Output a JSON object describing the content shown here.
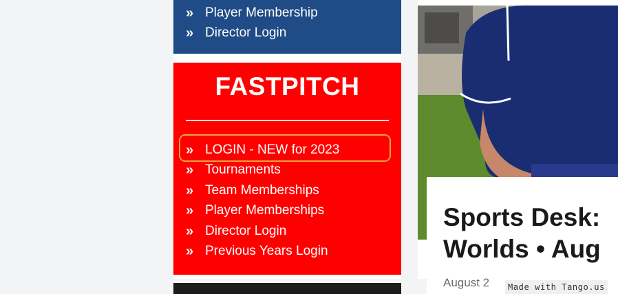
{
  "colors": {
    "blue_panel": "#1f4b86",
    "red_panel": "#ff0000",
    "highlight_border": "#f0a23a"
  },
  "blue_panel": {
    "items": [
      {
        "label": "Player Membership",
        "icon": "double-chevron-right-icon"
      },
      {
        "label": "Director Login",
        "icon": "double-chevron-right-icon"
      }
    ]
  },
  "fastpitch": {
    "title": "FASTPITCH",
    "items": [
      {
        "label": "LOGIN - NEW for 2023",
        "icon": "double-chevron-right-icon",
        "highlighted": true
      },
      {
        "label": "Tournaments",
        "icon": "double-chevron-right-icon"
      },
      {
        "label": "Team Memberships",
        "icon": "double-chevron-right-icon"
      },
      {
        "label": "Player Memberships",
        "icon": "double-chevron-right-icon"
      },
      {
        "label": "Director Login",
        "icon": "double-chevron-right-icon"
      },
      {
        "label": "Previous Years Login",
        "icon": "double-chevron-right-icon"
      }
    ]
  },
  "article": {
    "title_line1": "Sports Desk:",
    "title_line2": "Worlds • Aug",
    "date": "August 2"
  },
  "watermark": "Made with Tango.us"
}
